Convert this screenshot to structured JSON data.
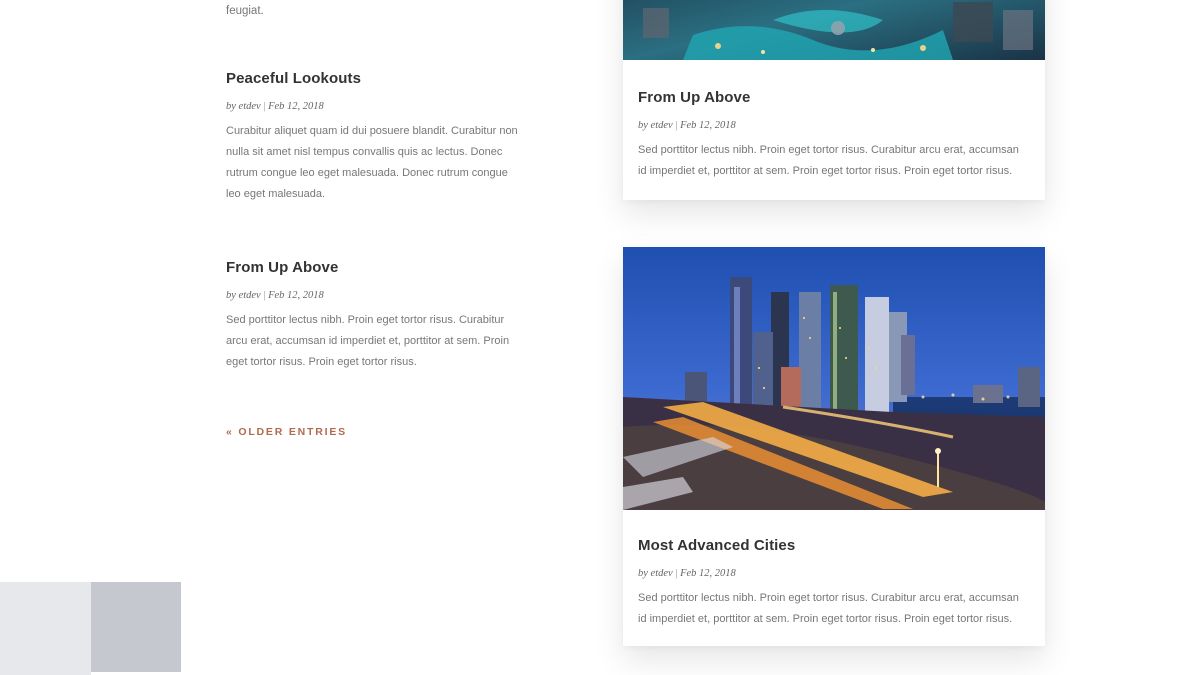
{
  "left_column": {
    "fragment": "feugiat.",
    "posts": [
      {
        "title": "Peaceful Lookouts",
        "author": "etdev",
        "by": "by",
        "date": "Feb 12, 2018",
        "excerpt": "Curabitur aliquet quam id dui posuere blandit. Curabitur non nulla sit amet nisl tempus convallis quis ac lectus. Donec rutrum congue leo eget malesuada. Donec rutrum congue leo eget malesuada."
      },
      {
        "title": "From Up Above",
        "author": "etdev",
        "by": "by",
        "date": "Feb 12, 2018",
        "excerpt": "Sed porttitor lectus nibh. Proin eget tortor risus. Curabitur arcu erat, accumsan id imperdiet et, porttitor at sem. Proin eget tortor risus. Proin eget tortor risus."
      }
    ],
    "older_entries": "« OLDER ENTRIES"
  },
  "right_column": {
    "cards": [
      {
        "title": "From Up Above",
        "by": "by",
        "author": "etdev",
        "date": "Feb 12, 2018",
        "excerpt": "Sed porttitor lectus nibh. Proin eget tortor risus. Curabitur arcu erat, accumsan id imperdiet et, porttitor at sem. Proin eget tortor risus. Proin eget tortor risus."
      },
      {
        "title": "Most Advanced Cities",
        "by": "by",
        "author": "etdev",
        "date": "Feb 12, 2018",
        "excerpt": "Sed porttitor lectus nibh. Proin eget tortor risus. Curabitur arcu erat, accumsan id imperdiet et, porttitor at sem. Proin eget tortor risus. Proin eget tortor risus."
      }
    ]
  },
  "colors": {
    "accent": "#b06a4c",
    "title": "#333333",
    "body_text": "#777777",
    "swatch_light": "#e7e8eb",
    "swatch_dark": "#c5c8ce"
  }
}
